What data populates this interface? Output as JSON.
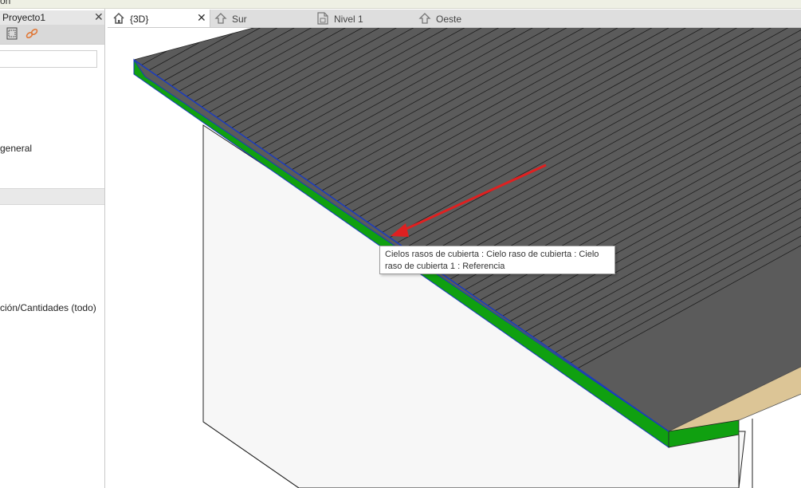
{
  "top_strip": {
    "partial_text": "ón"
  },
  "project_browser": {
    "title": "Proyecto1",
    "close_glyph": "✕",
    "tools": [
      "view-icon",
      "link-icon"
    ],
    "search": {
      "value": "",
      "placeholder": ""
    },
    "items": [
      {
        "label": "general"
      },
      {
        "label": "ción/Cantidades (todo)"
      }
    ]
  },
  "tabs": [
    {
      "label": "{3D}",
      "icon": "home-icon",
      "active": true,
      "close_glyph": "✕"
    },
    {
      "label": "Sur",
      "icon": "elevation-icon",
      "active": false
    },
    {
      "label": "Nivel 1",
      "icon": "floorplan-icon",
      "active": false
    },
    {
      "label": "Oeste",
      "icon": "elevation-icon",
      "active": false
    }
  ],
  "viewport": {
    "tooltip": {
      "line1": "Cielos rasos de cubierta : Cielo raso de cubierta : Cielo",
      "line2": "raso de cubierta 1 : Referencia"
    },
    "colors": {
      "roof": "#5b5b5b",
      "fascia": "#10a010",
      "fascia_edge": "#1a3bbf",
      "wall": "#f7f7f7",
      "soffit": "#dcc596",
      "annotation_arrow": "#e02020"
    }
  }
}
